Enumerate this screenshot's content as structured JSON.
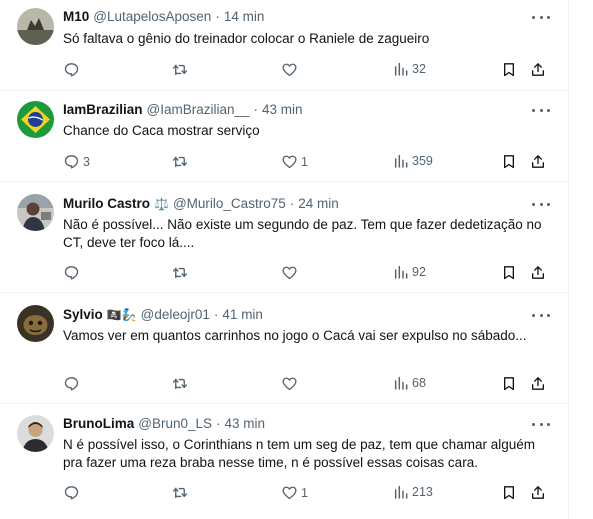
{
  "tweets": [
    {
      "name": "M10",
      "badge": "",
      "handle": "@LutapelosAposen",
      "dot": "·",
      "time": "14 min",
      "text": "Só faltava o gênio do treinador colocar o Raniele de zagueiro",
      "replies": "",
      "retweets": "",
      "likes": "",
      "views": "32"
    },
    {
      "name": "IamBrazilian",
      "badge": "",
      "handle": "@IamBrazilian__",
      "dot": "·",
      "time": "43 min",
      "text": "Chance do Caca mostrar serviço",
      "replies": "3",
      "retweets": "",
      "likes": "1",
      "views": "359"
    },
    {
      "name": "Murilo Castro",
      "badge": "⚖️",
      "handle": "@Murilo_Castro75",
      "dot": "·",
      "time": "24 min",
      "text": "Não é possível... Não existe um segundo de paz. Tem que fazer dedetização no CT, deve ter foco lá....",
      "replies": "",
      "retweets": "",
      "likes": "",
      "views": "92"
    },
    {
      "name": "Sylvio",
      "badge": "🏴‍☠️🧞",
      "handle": "@deleojr01",
      "dot": "·",
      "time": "41 min",
      "text": "Vamos ver em quantos carrinhos no jogo o Cacá vai ser expulso no sábado...",
      "replies": "",
      "retweets": "",
      "likes": "",
      "views": "68"
    },
    {
      "name": "BrunoLima",
      "badge": "",
      "handle": "@Brun0_LS",
      "dot": "·",
      "time": "43 min",
      "text": "N é possível isso, o Corinthians n tem um seg de paz, tem que chamar alguém pra fazer uma reza braba nesse time, n é possível essas coisas cara.",
      "replies": "",
      "retweets": "",
      "likes": "1",
      "views": "213"
    }
  ],
  "icons": {
    "reply": "reply-icon",
    "retweet": "retweet-icon",
    "like": "heart-icon",
    "views": "views-chart-icon",
    "bookmark": "bookmark-icon",
    "share": "share-icon",
    "more": "more-dots-icon"
  },
  "colors": {
    "text": "#0f1419",
    "secondary": "#536471",
    "divider": "#eff3f4"
  }
}
